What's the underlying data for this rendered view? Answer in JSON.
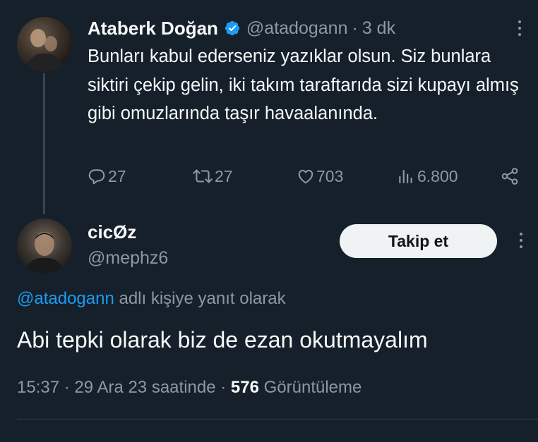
{
  "parent_tweet": {
    "author_name": "Ataberk Doğan",
    "handle": "@atadogann",
    "separator": "·",
    "time": "3 dk",
    "text": "Bunları kabul ederseniz yazıklar olsun. Siz bunlara siktiri çekip gelin, iki takım taraftarıda sizi kupayı almış gibi omuzlarında taşır havaalanında.",
    "stats": {
      "replies": "27",
      "retweets": "27",
      "likes": "703",
      "views": "6.800"
    },
    "icons": [
      "verified-badge-icon",
      "more-icon",
      "reply-icon",
      "retweet-icon",
      "like-icon",
      "views-icon",
      "share-icon"
    ]
  },
  "reply_tweet": {
    "author_name": "cicØz",
    "handle": "@mephz6",
    "follow_label": "Takip et",
    "reply_to_mention": "@atadogann",
    "reply_to_suffix": " adlı kişiye yanıt olarak",
    "text": "Abi tepki olarak biz de ezan okutmayalım",
    "time": "15:37",
    "separator": "·",
    "date": "29 Ara 23 saatinde",
    "view_count": "576",
    "view_label": "Görüntüleme"
  },
  "colors": {
    "background": "#15202b",
    "text_primary": "#f7f9f9",
    "text_secondary": "#8b98a5",
    "accent": "#1d9bf0",
    "divider": "#38444d"
  }
}
